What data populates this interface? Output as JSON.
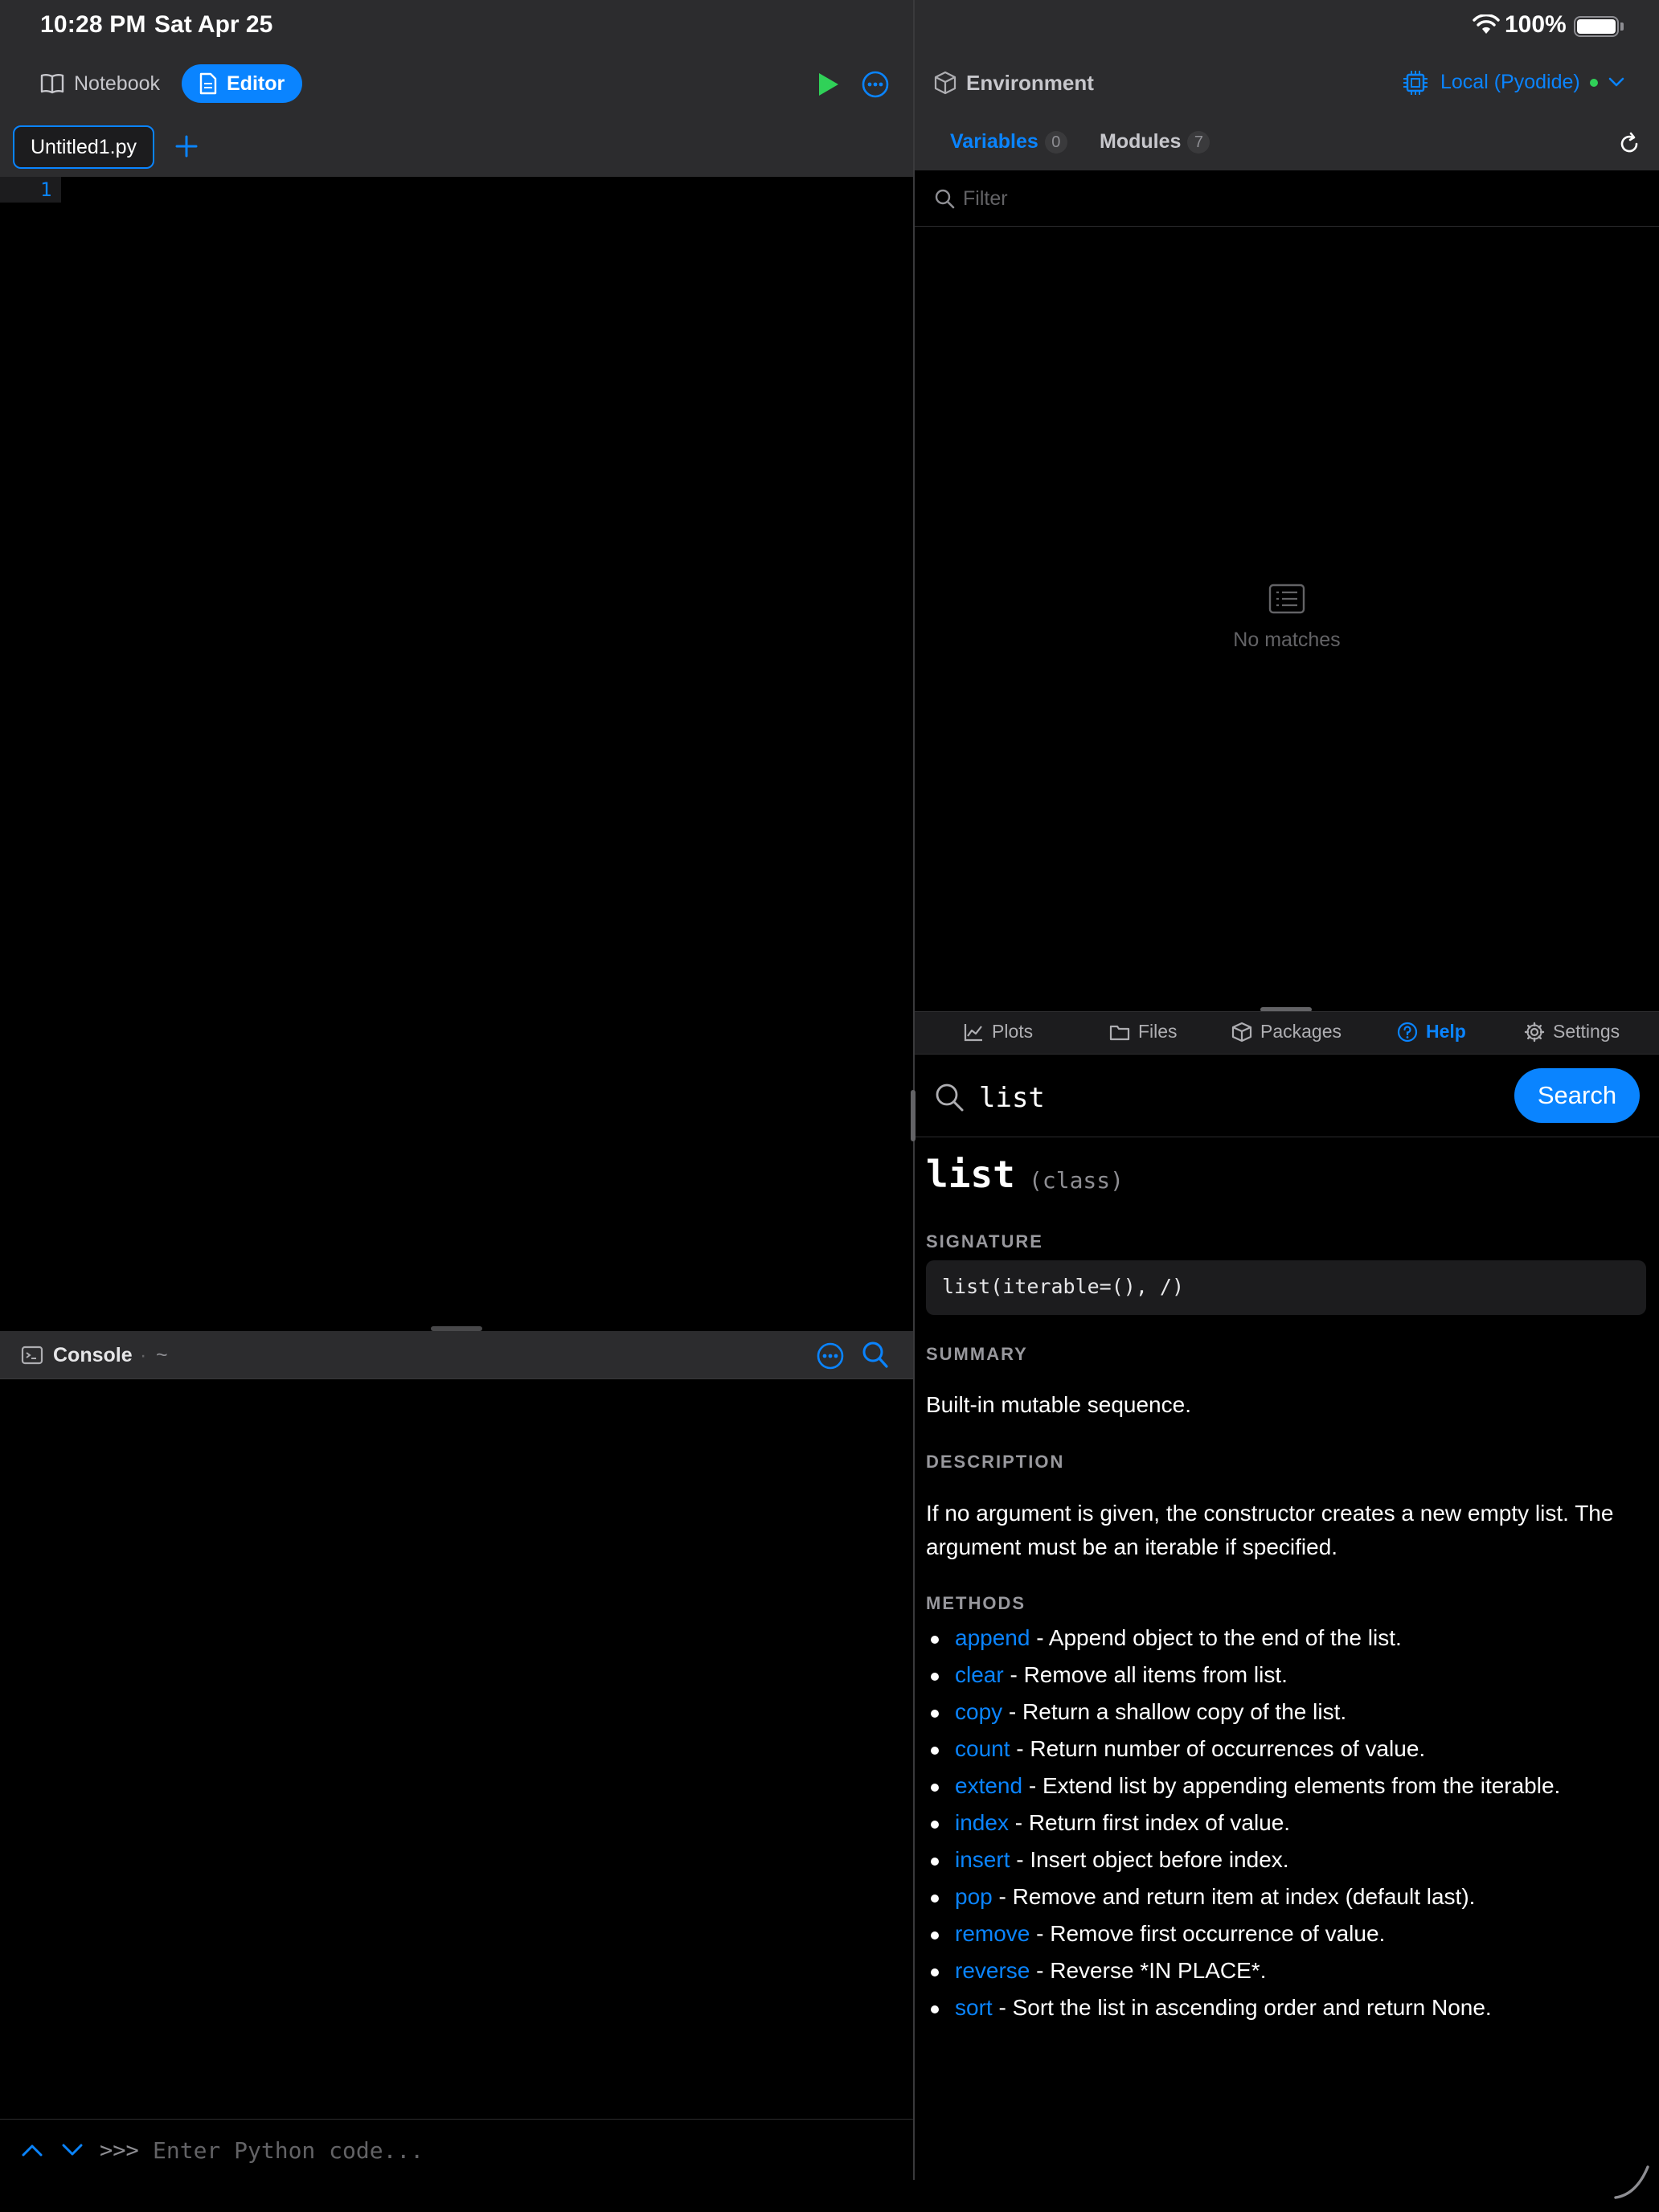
{
  "status_bar": {
    "time": "10:28 PM",
    "date": "Sat Apr 25",
    "battery": "100%"
  },
  "toolbar": {
    "notebook_label": "Notebook",
    "editor_label": "Editor"
  },
  "file_tabs": {
    "active": "Untitled1.py"
  },
  "editor": {
    "line_numbers": [
      "1"
    ]
  },
  "console": {
    "title": "Console",
    "separator": "·",
    "path": "~",
    "prompt": ">>>",
    "placeholder": "Enter Python code..."
  },
  "environment": {
    "title": "Environment",
    "kernel": "Local (Pyodide)",
    "tabs": [
      {
        "label": "Variables",
        "count": "0"
      },
      {
        "label": "Modules",
        "count": "7"
      }
    ],
    "filter_placeholder": "Filter",
    "empty_text": "No matches"
  },
  "bottom_tabs": [
    {
      "label": "Plots"
    },
    {
      "label": "Files"
    },
    {
      "label": "Packages"
    },
    {
      "label": "Help"
    },
    {
      "label": "Settings"
    }
  ],
  "help": {
    "query": "list",
    "search_label": "Search",
    "title": "list",
    "kind": "(class)",
    "signature_heading": "SIGNATURE",
    "signature": "list(iterable=(), /)",
    "summary_heading": "SUMMARY",
    "summary": "Built-in mutable sequence.",
    "description_heading": "DESCRIPTION",
    "description": "If no argument is given, the constructor creates a new empty list. The argument must be an iterable if specified.",
    "methods_heading": "METHODS",
    "methods": [
      {
        "name": "append",
        "desc": " - Append object to the end of the list."
      },
      {
        "name": "clear",
        "desc": " - Remove all items from list."
      },
      {
        "name": "copy",
        "desc": " - Return a shallow copy of the list."
      },
      {
        "name": "count",
        "desc": " - Return number of occurrences of value."
      },
      {
        "name": "extend",
        "desc": " - Extend list by appending elements from the iterable."
      },
      {
        "name": "index",
        "desc": " - Return first index of value."
      },
      {
        "name": "insert",
        "desc": " - Insert object before index."
      },
      {
        "name": "pop",
        "desc": " - Remove and return item at index (default last)."
      },
      {
        "name": "remove",
        "desc": " - Remove first occurrence of value."
      },
      {
        "name": "reverse",
        "desc": " - Reverse *IN PLACE*."
      },
      {
        "name": "sort",
        "desc": " - Sort the list in ascending order and return None."
      }
    ]
  },
  "colors": {
    "accent": "#0a84ff",
    "run": "#30d158",
    "kernel_status": "#30d158"
  }
}
